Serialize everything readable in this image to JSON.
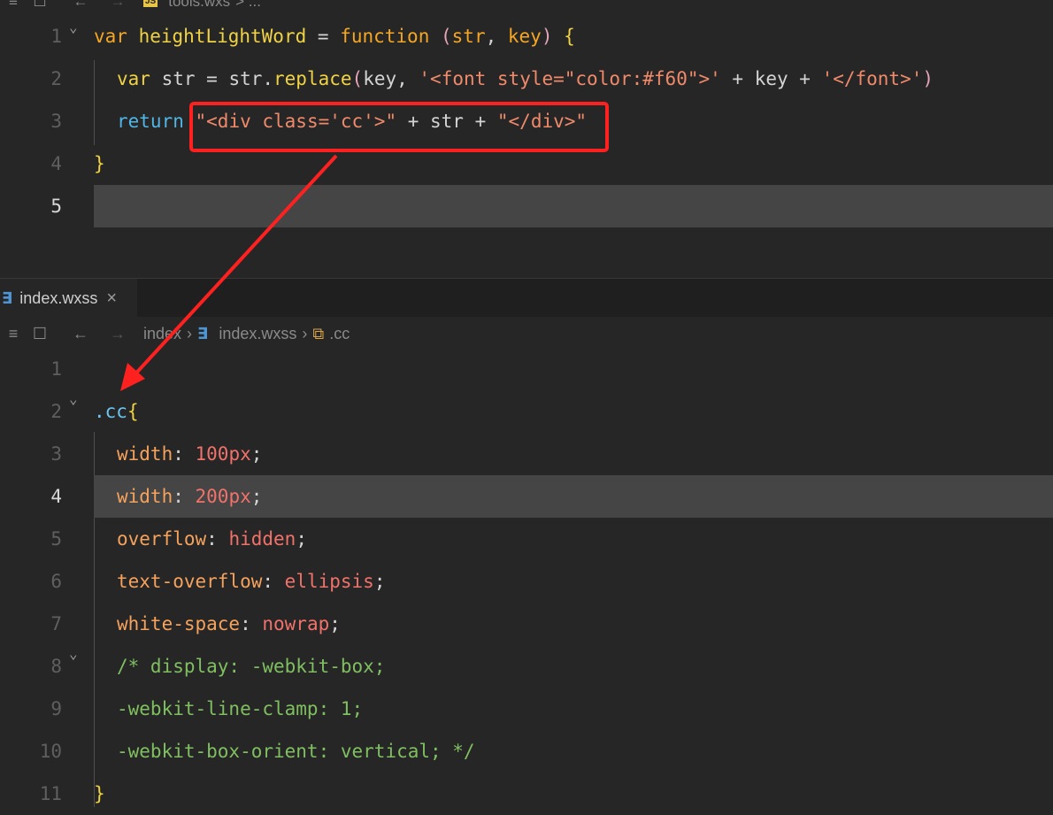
{
  "top_bar": {
    "file_badge": "JS",
    "file_name": "tools.wxs",
    "crumb_tail": "> ..."
  },
  "editor1": {
    "lines": [
      {
        "no": "1",
        "tokens": [
          [
            "kw",
            "var"
          ],
          [
            "punc",
            " "
          ],
          [
            "fn",
            "heightLightWord"
          ],
          [
            "punc",
            " = "
          ],
          [
            "kw",
            "function"
          ],
          [
            "punc",
            " "
          ],
          [
            "par",
            "("
          ],
          [
            "kw",
            "str"
          ],
          [
            "punc",
            ", "
          ],
          [
            "kw",
            "key"
          ],
          [
            "par",
            ")"
          ],
          [
            "punc",
            " "
          ],
          [
            "brc",
            "{"
          ]
        ]
      },
      {
        "no": "2",
        "tokens": [
          [
            "fn",
            "var"
          ],
          [
            "punc",
            " str = str."
          ],
          [
            "fn",
            "replace"
          ],
          [
            "par",
            "("
          ],
          [
            "punc",
            "key, "
          ],
          [
            "str",
            "'<font style=\"color:#f60\">'"
          ],
          [
            "punc",
            " + key + "
          ],
          [
            "str",
            "'</font>'"
          ],
          [
            "par",
            ")"
          ]
        ]
      },
      {
        "no": "3",
        "tokens": [
          [
            "kwb",
            "return"
          ],
          [
            "punc",
            " "
          ],
          [
            "str",
            "\"<div class='cc'>\""
          ],
          [
            "punc",
            " + str + "
          ],
          [
            "str",
            "\"</div>\""
          ]
        ]
      },
      {
        "no": "4",
        "tokens": [
          [
            "brc",
            "}"
          ]
        ]
      },
      {
        "no": "5",
        "tokens": []
      }
    ]
  },
  "tab": {
    "icon": "css3-icon",
    "title": "index.wxss",
    "close": "×"
  },
  "breadcrumb": {
    "folder": "index",
    "file": "index.wxss",
    "symbol": ".cc"
  },
  "editor2": {
    "lines": [
      {
        "no": "1",
        "tokens": []
      },
      {
        "no": "2",
        "tokens": [
          [
            "sel",
            ".cc"
          ],
          [
            "brc",
            "{"
          ]
        ]
      },
      {
        "no": "3",
        "tokens": [
          [
            "prop",
            "width"
          ],
          [
            "punc",
            ": "
          ],
          [
            "val",
            "100px"
          ],
          [
            "punc",
            ";"
          ]
        ]
      },
      {
        "no": "4",
        "tokens": [
          [
            "prop",
            "width"
          ],
          [
            "punc",
            ": "
          ],
          [
            "val",
            "200px"
          ],
          [
            "punc",
            ";"
          ]
        ]
      },
      {
        "no": "5",
        "tokens": [
          [
            "prop",
            "overflow"
          ],
          [
            "punc",
            ": "
          ],
          [
            "val",
            "hidden"
          ],
          [
            "punc",
            ";"
          ]
        ]
      },
      {
        "no": "6",
        "tokens": [
          [
            "prop",
            "text-overflow"
          ],
          [
            "punc",
            ": "
          ],
          [
            "val",
            "ellipsis"
          ],
          [
            "punc",
            ";"
          ]
        ]
      },
      {
        "no": "7",
        "tokens": [
          [
            "prop",
            "white-space"
          ],
          [
            "punc",
            ": "
          ],
          [
            "val",
            "nowrap"
          ],
          [
            "punc",
            ";"
          ]
        ]
      },
      {
        "no": "8",
        "tokens": [
          [
            "cm",
            "/* display: -webkit-box;"
          ]
        ]
      },
      {
        "no": "9",
        "tokens": [
          [
            "cm",
            "-webkit-line-clamp: 1;"
          ]
        ]
      },
      {
        "no": "10",
        "tokens": [
          [
            "cm",
            "-webkit-box-orient: vertical; */"
          ]
        ]
      },
      {
        "no": "11",
        "tokens": [
          [
            "brc",
            "}"
          ]
        ]
      }
    ]
  },
  "colors": {
    "annotation": "#ff2020",
    "background": "#262626",
    "highlight": "#454545"
  }
}
